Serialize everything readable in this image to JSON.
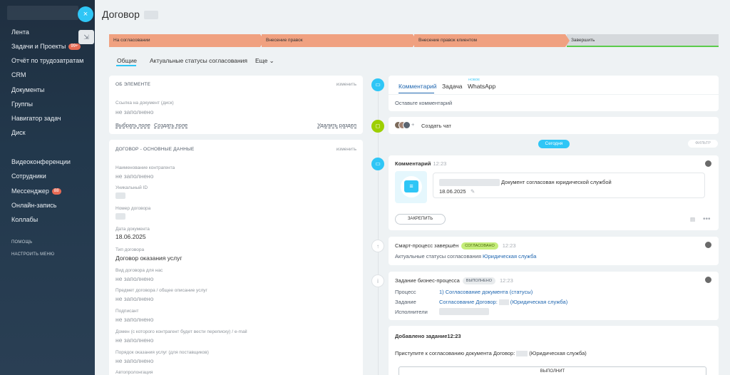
{
  "sidebar": {
    "items": [
      {
        "label": "Лента"
      },
      {
        "label": "Задачи и Проекты",
        "badge": "99+"
      },
      {
        "label": "Отчёт по трудозатратам"
      },
      {
        "label": "CRM"
      },
      {
        "label": "Документы"
      },
      {
        "label": "Группы"
      },
      {
        "label": "Навигатор задач"
      },
      {
        "label": "Диск"
      },
      {
        "label": "Видеоконференции"
      },
      {
        "label": "Сотрудники"
      },
      {
        "label": "Мессенджер",
        "badge": "88"
      },
      {
        "label": "Онлайн-запись"
      },
      {
        "label": "Коллабы"
      }
    ],
    "help": "ПОМОЩЬ",
    "settings": "НАСТРОИТЬ МЕНЮ",
    "close_icon": "×",
    "pin_icon": "⇲"
  },
  "header": {
    "title": "Договор"
  },
  "stages": [
    {
      "label": "На согласовании"
    },
    {
      "label": "Внесение правок"
    },
    {
      "label": "Внесение правок клиентом"
    },
    {
      "label": "Завершить"
    }
  ],
  "tabs": [
    {
      "label": "Общие"
    },
    {
      "label": "Актуальные статусы согласования"
    },
    {
      "label": "Еще ⌄"
    }
  ],
  "about": {
    "head": "ОБ ЭЛЕМЕНТЕ",
    "edit": "изменить",
    "field_label": "Ссылка на документ (диск)",
    "field_value": "не заполнено",
    "select_field": "Выбрать поле",
    "create_field": "Создать поле",
    "delete_section": "Удалить раздел"
  },
  "main_data": {
    "head": "ДОГОВОР - ОСНОВНЫЕ ДАННЫЕ",
    "edit": "изменить",
    "fields": [
      {
        "label": "Наименование контрагента",
        "value": "не заполнено"
      },
      {
        "label": "Уникальный ID",
        "value": ""
      },
      {
        "label": "Номер договора",
        "value": ""
      },
      {
        "label": "Дата документа",
        "value": "18.06.2025"
      },
      {
        "label": "Тип договора",
        "value": "Договор оказания услуг"
      },
      {
        "label": "Вид договора для нас",
        "value": "не заполнено"
      },
      {
        "label": "Предмет договора / общее описание услуг",
        "value": "не заполнено"
      },
      {
        "label": "Подписант",
        "value": "не заполнено"
      },
      {
        "label": "Домен (с которого контрагент будет вести переписку) / e-mail",
        "value": "не заполнено"
      },
      {
        "label": "Порядок оказания услуг (для поставщиков)",
        "value": "не заполнено"
      },
      {
        "label": "Автопролонгация",
        "value": ""
      }
    ]
  },
  "timeline": {
    "composer": {
      "tabs": [
        "Комментарий",
        "Задача",
        "WhatsApp"
      ],
      "new_label": "НОВОЕ",
      "placeholder": "Оставьте комментарий"
    },
    "chat": {
      "label": "Создать чат"
    },
    "today": "Сегодня",
    "filter": "ФИЛЬТР",
    "comment": {
      "title": "Комментарий",
      "time": "12:23",
      "text": "Документ согласован юридической службой",
      "date": "18.06.2025",
      "pin": "ЗАКРЕПИТЬ"
    },
    "process": {
      "title": "Смарт-процесс завершён",
      "badge": "СОГЛАСОВАНО",
      "time": "12:23",
      "text": "Актуальные статусы согласования",
      "link": "Юридическая служба"
    },
    "bp_task": {
      "title": "Задание бизнес-процесса",
      "badge": "ВЫПОЛНЕНО",
      "time": "12:23",
      "process_label": "Процесс",
      "process_value": "1) Согласование документа (статусы)",
      "task_label": "Задание",
      "task_value_a": "Согласование Договор:",
      "task_value_b": "(Юридическая служба)",
      "exec_label": "Исполнители"
    },
    "added_task": {
      "title": "Добавлено задание",
      "time": "12:23",
      "text_a": "Приступите к согласованию документа Договор:",
      "text_b": "(Юридическая служба)",
      "button": "ВЫПОЛНИТ"
    }
  },
  "colors": {
    "accent": "#2fc6f6",
    "stage_orange": "#f0a180",
    "stage_grey": "#d5d9dc",
    "green": "#9dcf00"
  }
}
